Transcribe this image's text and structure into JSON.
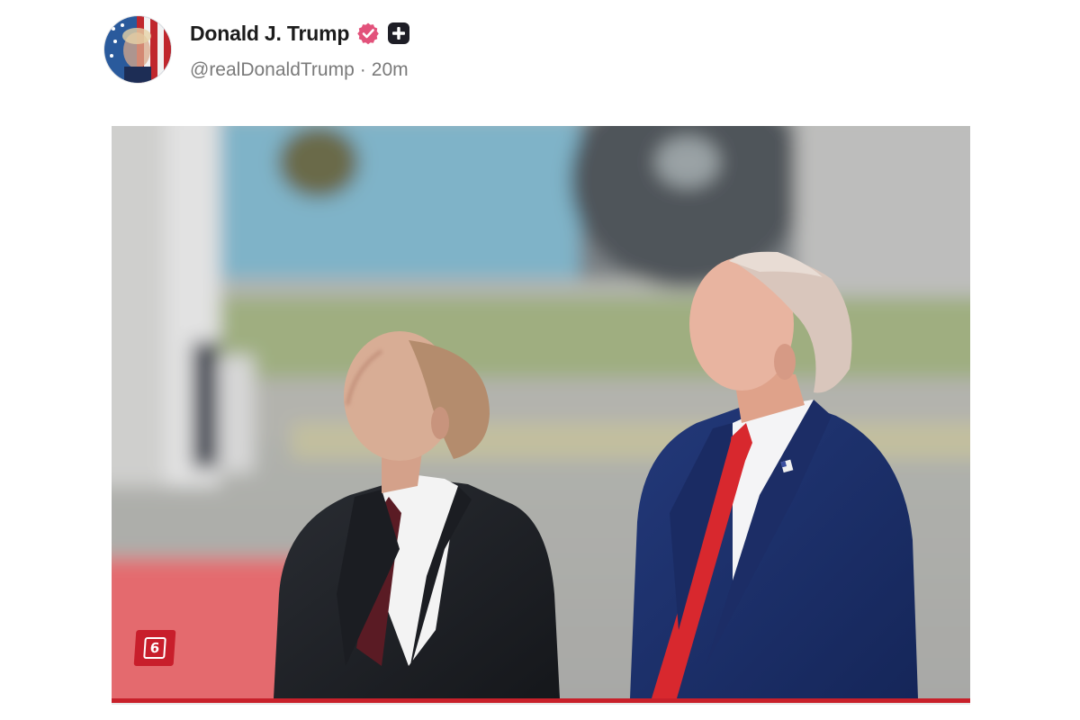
{
  "post": {
    "author": {
      "display_name": "Donald J. Trump",
      "handle": "@realDonaldTrump",
      "avatar_icon": "flag-portrait-avatar"
    },
    "separator": "·",
    "time_ago": "20m",
    "badges": {
      "verified_icon": "verified-icon",
      "verified_color": "#e2527b",
      "action_icon": "plus-icon"
    },
    "media": {
      "image_description_icon": "photo",
      "watermark_label": "6",
      "watermark_color": "#c81e2b"
    }
  }
}
